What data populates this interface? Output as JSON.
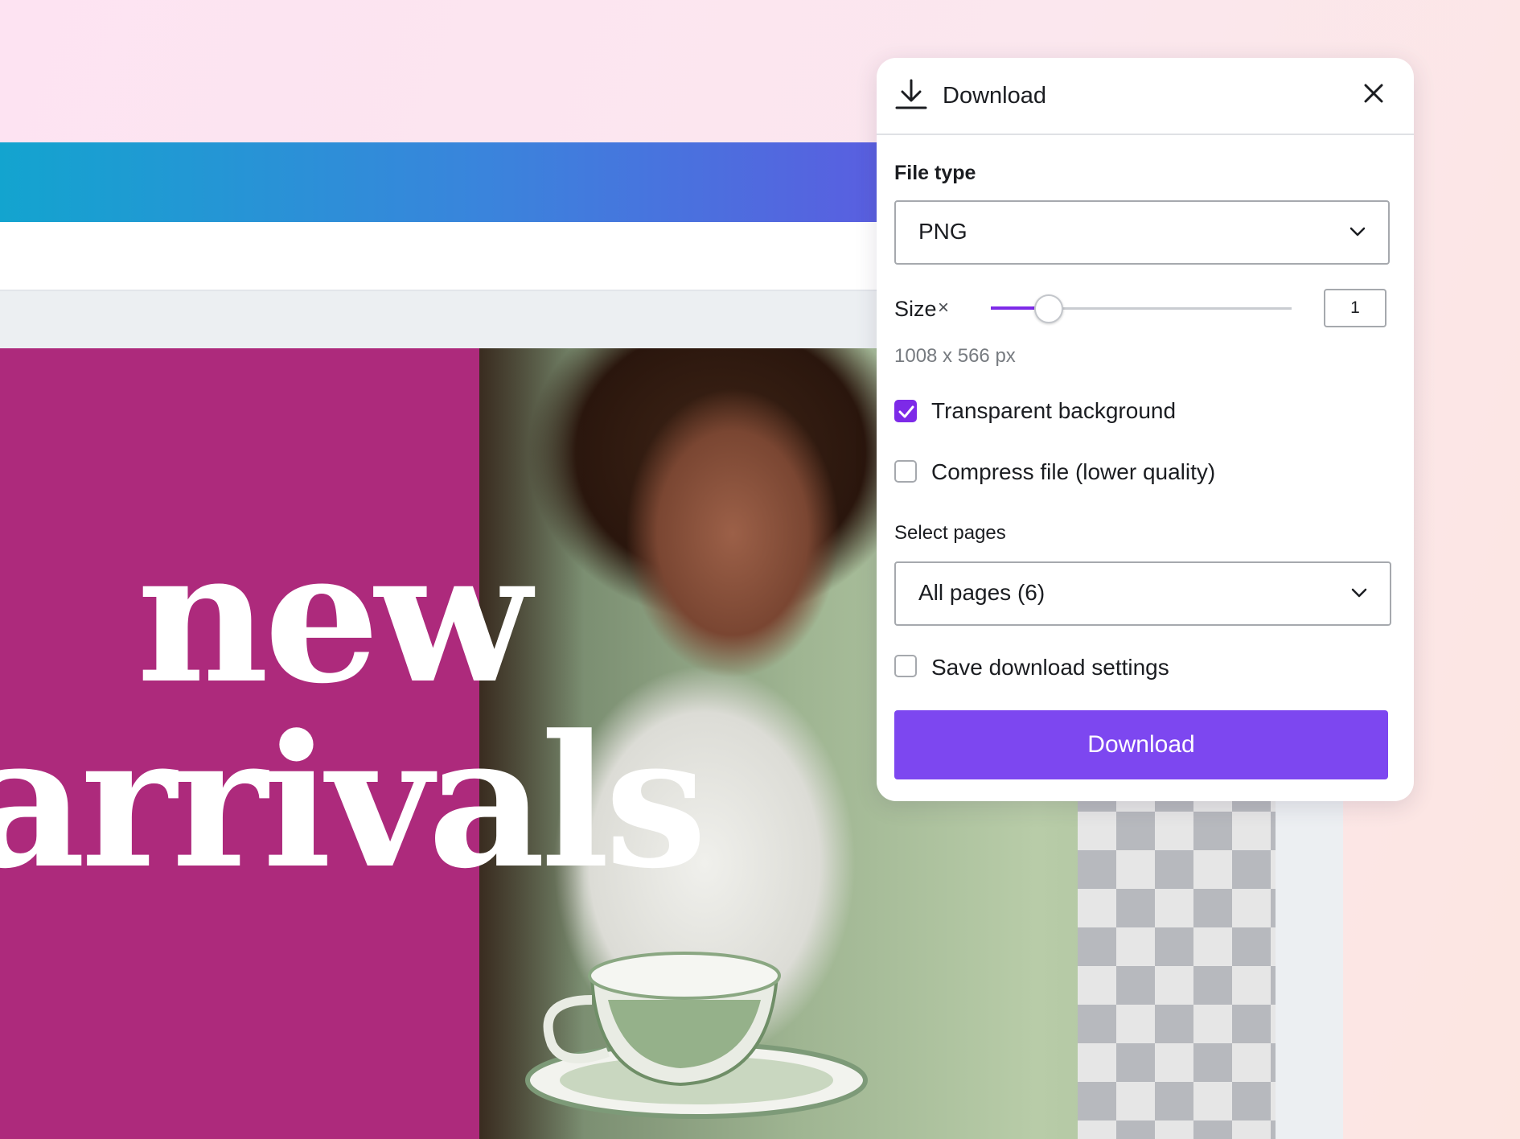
{
  "design": {
    "headline_line1": "new",
    "headline_line2": "arrivals",
    "magenta_color": "#ad2a7c"
  },
  "download_panel": {
    "title": "Download",
    "header_icon": "download-icon",
    "close_icon": "close-icon",
    "file_type_label": "File type",
    "file_type_value": "PNG",
    "size_label": "Size",
    "size_reset_symbol": "×",
    "size_multiplier": "1",
    "size_slider_fraction": 0.16,
    "dimensions_text": "1008 x 566 px",
    "transparent_background": {
      "label": "Transparent background",
      "checked": true
    },
    "compress_file": {
      "label": "Compress file (lower quality)",
      "checked": false
    },
    "select_pages_label": "Select pages",
    "select_pages_value": "All pages (6)",
    "save_settings": {
      "label": "Save download settings",
      "checked": false
    },
    "download_button_label": "Download",
    "accent_color": "#7d2ae8",
    "button_color": "#7d47f0"
  }
}
